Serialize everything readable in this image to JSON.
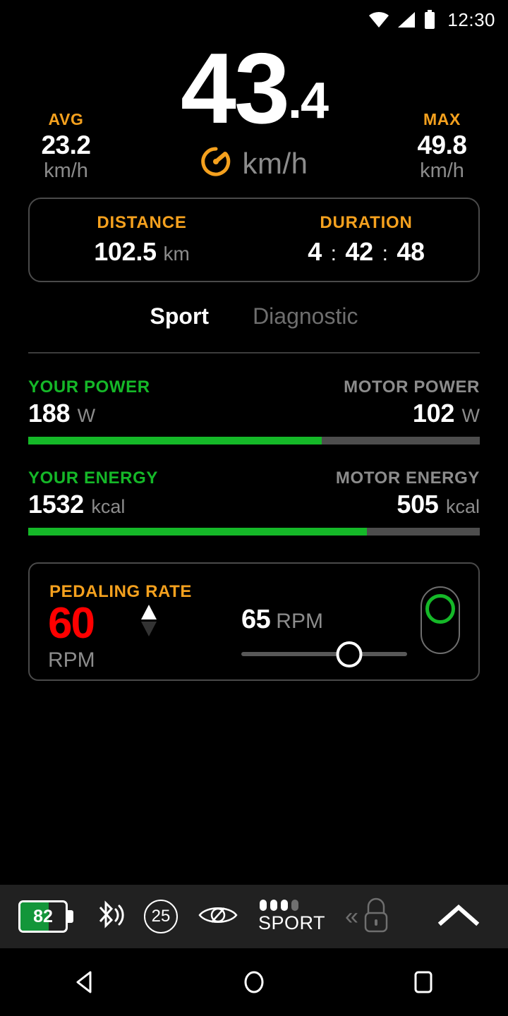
{
  "status_bar": {
    "wifi_icon": "wifi-icon",
    "signal_icon": "signal-icon",
    "battery_icon": "battery-icon",
    "time": "12:30"
  },
  "speed": {
    "integer": "43",
    "decimal": ".4",
    "unit": "km/h",
    "gauge_icon": "speedometer-icon",
    "avg": {
      "label": "AVG",
      "value": "23.2",
      "unit": "km/h"
    },
    "max": {
      "label": "MAX",
      "value": "49.8",
      "unit": "km/h"
    }
  },
  "trip": {
    "distance": {
      "label": "DISTANCE",
      "value": "102.5",
      "unit": "km"
    },
    "duration": {
      "label": "DURATION",
      "hours": "4",
      "minutes": "42",
      "seconds": "48",
      "separator": ":"
    }
  },
  "tabs": [
    {
      "label": "Sport",
      "active": true
    },
    {
      "label": "Diagnostic",
      "active": false
    }
  ],
  "power": {
    "your": {
      "label": "YOUR POWER",
      "value": "188",
      "unit": "W"
    },
    "motor": {
      "label": "MOTOR POWER",
      "value": "102",
      "unit": "W"
    },
    "fill_percent": 65
  },
  "energy": {
    "your": {
      "label": "YOUR ENERGY",
      "value": "1532",
      "unit": "kcal"
    },
    "motor": {
      "label": "MOTOR ENERGY",
      "value": "505",
      "unit": "kcal"
    },
    "fill_percent": 75
  },
  "pedaling": {
    "title": "PEDALING RATE",
    "current_value": "60",
    "current_unit": "RPM",
    "target_value": "65",
    "target_unit": "RPM",
    "slider_percent": 65,
    "trend_up_icon": "arrow-up-icon",
    "trend_down_icon": "arrow-down-icon",
    "indicator_icon": "assist-level-indicator-icon"
  },
  "toolbar": {
    "battery": {
      "percent_label": "82",
      "fill_percent": 62
    },
    "bluetooth_icon": "bluetooth-connected-icon",
    "speed_limit": "25",
    "eye_off_icon": "eye-off-icon",
    "assist_mode": {
      "label": "SPORT",
      "dots_on": 3,
      "dots_total": 4
    },
    "lock_icon": "lock-icon",
    "lock_chevrons": "«",
    "expand_icon": "chevron-up-icon"
  },
  "navbar": {
    "back_icon": "back-triangle-icon",
    "home_icon": "home-circle-icon",
    "recents_icon": "recents-square-icon"
  },
  "colors": {
    "accent_orange": "#F5A11E",
    "accent_green": "#15B828",
    "alert_red": "#FF0000",
    "muted_gray": "#8c8c8c",
    "background": "#000000",
    "toolbar_bg": "#212121"
  }
}
